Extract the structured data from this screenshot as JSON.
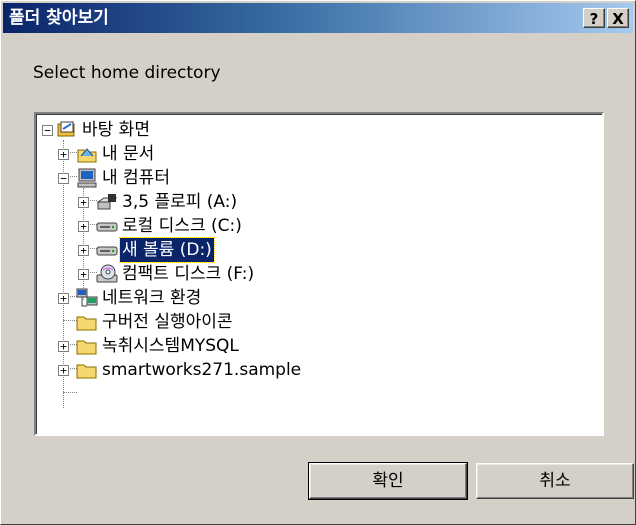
{
  "window": {
    "title": "폴더 찾아보기",
    "help_label": "?",
    "close_label": "X"
  },
  "instruction": "Select home directory",
  "tree": {
    "items": [
      {
        "label": "바탕 화면",
        "icon": "desktop-icon",
        "expander": "minus"
      },
      {
        "label": "내 문서",
        "icon": "my-documents-icon",
        "expander": "plus"
      },
      {
        "label": "내 컴퓨터",
        "icon": "my-computer-icon",
        "expander": "minus"
      },
      {
        "label": "3,5 플로피 (A:)",
        "icon": "floppy-drive-icon",
        "expander": "plus"
      },
      {
        "label": "로컬 디스크 (C:)",
        "icon": "hard-drive-icon",
        "expander": "plus"
      },
      {
        "label": "새 볼륨 (D:)",
        "icon": "hard-drive-icon",
        "expander": "plus",
        "selected": true
      },
      {
        "label": "컴팩트 디스크 (F:)",
        "icon": "cd-drive-icon",
        "expander": "plus"
      },
      {
        "label": "네트워크 환경",
        "icon": "network-icon",
        "expander": "plus"
      },
      {
        "label": "구버전 실행아이콘",
        "icon": "folder-icon",
        "expander": "none"
      },
      {
        "label": "녹취시스템MYSQL",
        "icon": "folder-icon",
        "expander": "plus"
      },
      {
        "label": "smartworks271.sample",
        "icon": "folder-icon",
        "expander": "plus"
      }
    ]
  },
  "buttons": {
    "ok_label": "확인",
    "cancel_label": "취소"
  },
  "colors": {
    "selection": "#0a246a",
    "face": "#d4d0c8",
    "title_start": "#0a246a",
    "title_end": "#a6caf0"
  }
}
